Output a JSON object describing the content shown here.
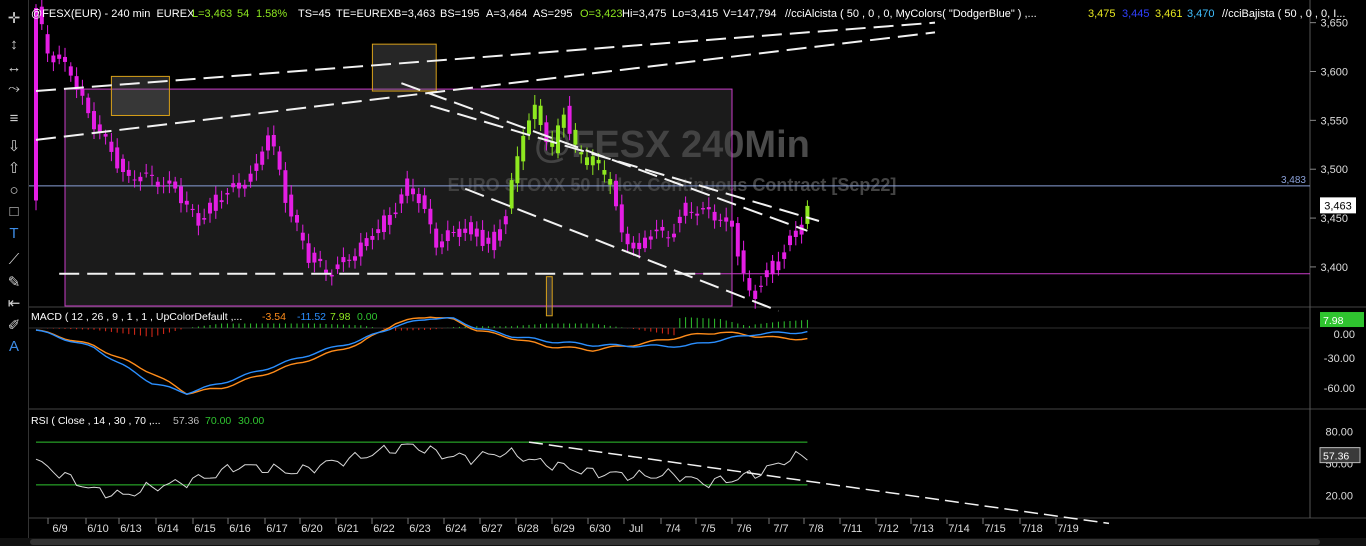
{
  "toolbar": {
    "tools": [
      {
        "name": "crosshair-icon",
        "glyph": "✛"
      },
      {
        "name": "vertical-arrows-icon",
        "glyph": "↕"
      },
      {
        "name": "horizontal-arrows-icon",
        "glyph": "↔"
      },
      {
        "name": "freehand-icon",
        "glyph": "⤳"
      },
      {
        "name": "horizontal-lines-icon",
        "glyph": "≡"
      },
      {
        "name": "arrow-down-icon",
        "glyph": "⇩"
      },
      {
        "name": "arrow-up-icon",
        "glyph": "⇧"
      },
      {
        "name": "ellipse-icon",
        "glyph": "○"
      },
      {
        "name": "rectangle-icon",
        "glyph": "□"
      },
      {
        "name": "text-tool-icon",
        "glyph": "T"
      },
      {
        "name": "trendline-icon",
        "glyph": "⟋"
      },
      {
        "name": "pen-icon",
        "glyph": "✎"
      },
      {
        "name": "cursor-bar-icon",
        "glyph": "⇤"
      },
      {
        "name": "eraser-icon",
        "glyph": "✐"
      },
      {
        "name": "text-box-icon",
        "glyph": "A"
      }
    ]
  },
  "header": {
    "symbol": "@FESX(EUR) - 240 min  EUREX",
    "last": "L=3,463",
    "change": "54",
    "pct": "1.58%",
    "ts": "TS=45",
    "exch": "TE=EUREX",
    "bid": "B=3,463",
    "bidsize": "BS=195",
    "ask": "A=3,464",
    "asksize": "AS=295",
    "open": "O=3,423",
    "hi": "Hi=3,475",
    "lo": "Lo=3,415",
    "vol": "V=147,794",
    "ind1": "//cciAlcista ( 50 , 0 , 0, MyColors( \"DodgerBlue\" ) ,...",
    "v1": "3,475",
    "v2": "3,445",
    "v3": "3,461",
    "v4": "3,470",
    "ind2": "//cciBajista ( 50 , 0 , 0, I..."
  },
  "watermark": {
    "title": "@FESX 240Min",
    "subtitle": "EURO STOXX 50 Index Continuous Contract [Sep22]"
  },
  "colors": {
    "up": "#8ee820",
    "down": "#e41ee4",
    "signal": "#ff8c1a",
    "macd": "#2b8fff",
    "hist_up": "#2fc42f",
    "hist_down": "#e02a1a",
    "rsi": "#d8d8d8",
    "rsi_band": "#2fc42f",
    "box": "#c83cc8",
    "label": "#ffffff",
    "grid": "#333333"
  },
  "price_pane": {
    "y_ticks": [
      "3,650",
      "3,600",
      "3,550",
      "3,500",
      "3,450",
      "3,400"
    ],
    "ref_label": "3,483",
    "last_label": "3,463"
  },
  "macd_pane": {
    "legend": "MACD ( 12 , 26 , 9 , 1 , 1 , UpColorDefault ,...",
    "v_macd": "-3.54",
    "v_signal": "-11.52",
    "v_hist": "7.98",
    "v_zero": "0.00",
    "y_ticks": [
      "0.00",
      "-30.00",
      "-60.00"
    ],
    "last_label": "7.98"
  },
  "rsi_pane": {
    "legend": "RSI ( Close , 14 , 30 , 70 ,...",
    "v_rsi": "57.36",
    "v_ob": "70.00",
    "v_os": "30.00",
    "y_ticks": [
      "80.00",
      "50.00",
      "20.00"
    ],
    "last_label": "57.36"
  },
  "chart_data": {
    "type": "candlestick",
    "x_labels": [
      "6/9",
      "6/10",
      "6/13",
      "6/14",
      "6/15",
      "6/16",
      "6/17",
      "6/20",
      "6/21",
      "6/22",
      "6/23",
      "6/24",
      "6/27",
      "6/28",
      "6/29",
      "6/30",
      "Jul",
      "7/4",
      "7/5",
      "7/6",
      "7/7",
      "7/8",
      "7/11",
      "7/12",
      "7/13",
      "7/14",
      "7/15",
      "7/18",
      "7/19"
    ],
    "price_ylim": [
      3360,
      3665
    ],
    "price_ticks": [
      3650,
      3600,
      3550,
      3500,
      3450,
      3400
    ],
    "ref_level": 3483,
    "last": 3463,
    "price_path": [
      [
        0,
        3665
      ],
      [
        2,
        3620
      ],
      [
        6,
        3600
      ],
      [
        9,
        3555
      ],
      [
        12,
        3530
      ],
      [
        15,
        3495
      ],
      [
        20,
        3490
      ],
      [
        24,
        3480
      ],
      [
        28,
        3445
      ],
      [
        31,
        3470
      ],
      [
        34,
        3480
      ],
      [
        38,
        3500
      ],
      [
        40,
        3540
      ],
      [
        41,
        3520
      ],
      [
        43,
        3470
      ],
      [
        47,
        3410
      ],
      [
        50,
        3395
      ],
      [
        52,
        3400
      ],
      [
        56,
        3420
      ],
      [
        59,
        3440
      ],
      [
        62,
        3460
      ],
      [
        64,
        3485
      ],
      [
        66,
        3470
      ],
      [
        69,
        3425
      ],
      [
        72,
        3435
      ],
      [
        75,
        3440
      ],
      [
        78,
        3420
      ],
      [
        81,
        3455
      ],
      [
        84,
        3540
      ],
      [
        86,
        3560
      ],
      [
        89,
        3520
      ],
      [
        91,
        3560
      ],
      [
        93,
        3520
      ],
      [
        96,
        3505
      ],
      [
        99,
        3490
      ],
      [
        101,
        3430
      ],
      [
        104,
        3420
      ],
      [
        107,
        3440
      ],
      [
        109,
        3430
      ],
      [
        112,
        3460
      ],
      [
        116,
        3455
      ],
      [
        118,
        3450
      ],
      [
        120,
        3440
      ],
      [
        123,
        3370
      ],
      [
        125,
        3385
      ],
      [
        128,
        3410
      ],
      [
        131,
        3435
      ],
      [
        133,
        3463
      ]
    ],
    "rectangles": [
      [
        5,
        3582,
        120,
        3360
      ],
      [
        13,
        3595,
        23,
        3555
      ],
      [
        58,
        3628,
        69,
        3580
      ],
      [
        88,
        3390,
        89,
        3350
      ]
    ],
    "support_level": 3393,
    "support_start": 4,
    "support_end": 118,
    "dashed_trendlines": [
      [
        0,
        3580,
        155,
        3650
      ],
      [
        0,
        3530,
        155,
        3640
      ],
      [
        63,
        3588,
        133,
        3437
      ],
      [
        68,
        3565,
        135,
        3447
      ],
      [
        74,
        3480,
        128,
        3355
      ]
    ],
    "macd_ylim": [
      -80,
      20
    ],
    "macd_ticks": [
      0,
      -30,
      -60
    ],
    "macd_path": [
      [
        0,
        -2
      ],
      [
        10,
        -20
      ],
      [
        20,
        -55
      ],
      [
        26,
        -65
      ],
      [
        32,
        -55
      ],
      [
        40,
        -40
      ],
      [
        48,
        -25
      ],
      [
        56,
        -12
      ],
      [
        62,
        2
      ],
      [
        68,
        10
      ],
      [
        72,
        9
      ],
      [
        76,
        0
      ],
      [
        82,
        -8
      ],
      [
        88,
        -13
      ],
      [
        96,
        -17
      ],
      [
        104,
        -18
      ],
      [
        112,
        -18
      ],
      [
        118,
        -12
      ],
      [
        124,
        -6
      ],
      [
        128,
        -5
      ],
      [
        133,
        -4
      ]
    ],
    "signal_path": [
      [
        0,
        -2
      ],
      [
        10,
        -18
      ],
      [
        20,
        -45
      ],
      [
        26,
        -65
      ],
      [
        32,
        -60
      ],
      [
        40,
        -45
      ],
      [
        48,
        -30
      ],
      [
        56,
        -15
      ],
      [
        62,
        5
      ],
      [
        68,
        12
      ],
      [
        72,
        8
      ],
      [
        76,
        -2
      ],
      [
        82,
        -10
      ],
      [
        88,
        -18
      ],
      [
        96,
        -22
      ],
      [
        104,
        -16
      ],
      [
        112,
        -8
      ],
      [
        118,
        -4
      ],
      [
        124,
        -8
      ],
      [
        128,
        -10
      ],
      [
        133,
        -11
      ]
    ],
    "hist_last": 7.98,
    "rsi_ylim": [
      0,
      100
    ],
    "rsi_ticks": [
      80,
      50,
      20
    ],
    "rsi_ob": 70,
    "rsi_os": 30,
    "rsi_path": [
      [
        0,
        52
      ],
      [
        5,
        38
      ],
      [
        10,
        25
      ],
      [
        15,
        20
      ],
      [
        20,
        28
      ],
      [
        25,
        32
      ],
      [
        30,
        38
      ],
      [
        35,
        48
      ],
      [
        40,
        45
      ],
      [
        45,
        42
      ],
      [
        50,
        50
      ],
      [
        55,
        55
      ],
      [
        60,
        62
      ],
      [
        65,
        67
      ],
      [
        70,
        58
      ],
      [
        75,
        55
      ],
      [
        80,
        60
      ],
      [
        83,
        58
      ],
      [
        86,
        52
      ],
      [
        90,
        48
      ],
      [
        95,
        42
      ],
      [
        100,
        40
      ],
      [
        105,
        38
      ],
      [
        110,
        40
      ],
      [
        115,
        32
      ],
      [
        120,
        35
      ],
      [
        125,
        42
      ],
      [
        130,
        55
      ],
      [
        133,
        57
      ]
    ],
    "rsi_last": 57.36,
    "rsi_trendline": [
      85,
      70,
      185,
      -6
    ]
  }
}
